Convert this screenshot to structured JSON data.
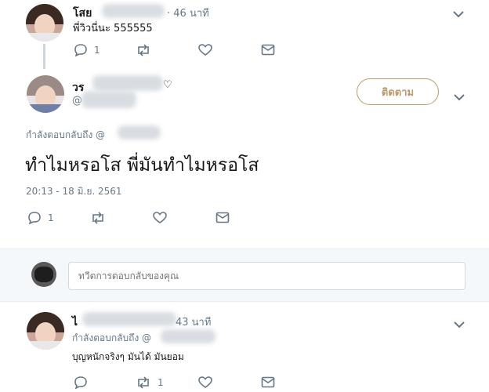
{
  "tweet1": {
    "name": "โสย",
    "time": "· 46 นาที",
    "text": "พี่วิวนี่นะ 555555",
    "reply_count": "1"
  },
  "main_tweet": {
    "name": "วร",
    "handle": "@",
    "follow_label": "ติดตาม",
    "replying_to": "กำลังตอบกลับถึง @",
    "text": "ทำไมหรอโส พี่มันทำไมหรอโส",
    "timestamp": "20:13 - 18 มิ.ย. 2561",
    "reply_count": "1"
  },
  "composer": {
    "placeholder": "ทวีตการตอบกลับของคุณ"
  },
  "tweet2": {
    "name": "ไ",
    "time": "43 นาที",
    "replying_to": "กำลังตอบกลับถึง @",
    "text": "บุญหนักจริงๆ มันได้ มันยอม",
    "retweet_count": "1"
  },
  "colors": {
    "accent": "#b99b6b",
    "muted": "#657786",
    "composer_bg": "#f5f8fa",
    "border": "#e6ecf0"
  }
}
